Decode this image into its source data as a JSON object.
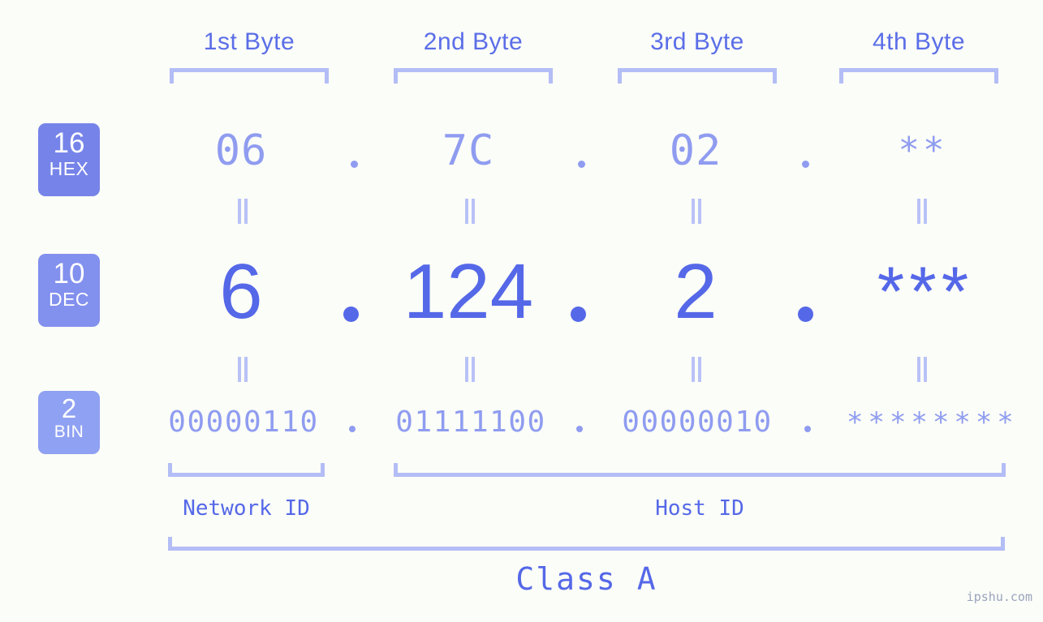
{
  "page": {
    "background_color": "#fbfdf8",
    "accent_color": "#5568e8",
    "accent_light_color": "#8f9cf0",
    "bracket_color": "#b3bdf6"
  },
  "byte_headers": [
    {
      "label": "1st Byte"
    },
    {
      "label": "2nd Byte"
    },
    {
      "label": "3rd Byte"
    },
    {
      "label": "4th Byte"
    }
  ],
  "bases": [
    {
      "number": "16",
      "name": "HEX",
      "color": "#7684e9"
    },
    {
      "number": "10",
      "name": "DEC",
      "color": "#8290ee"
    },
    {
      "number": "2",
      "name": "BIN",
      "color": "#8fa1f2"
    }
  ],
  "rows": {
    "hex": {
      "values": [
        "06",
        "7C",
        "02",
        "**"
      ]
    },
    "dec": {
      "values": [
        "6",
        "124",
        "2",
        "***"
      ]
    },
    "bin": {
      "values": [
        "00000110",
        "01111100",
        "00000010",
        "********"
      ]
    }
  },
  "separator": ".",
  "equivalence_symbol": "=",
  "sections": [
    {
      "label": "Network ID"
    },
    {
      "label": "Host ID"
    }
  ],
  "class": {
    "label": "Class A"
  },
  "watermark": {
    "text": "ipshu.com"
  }
}
